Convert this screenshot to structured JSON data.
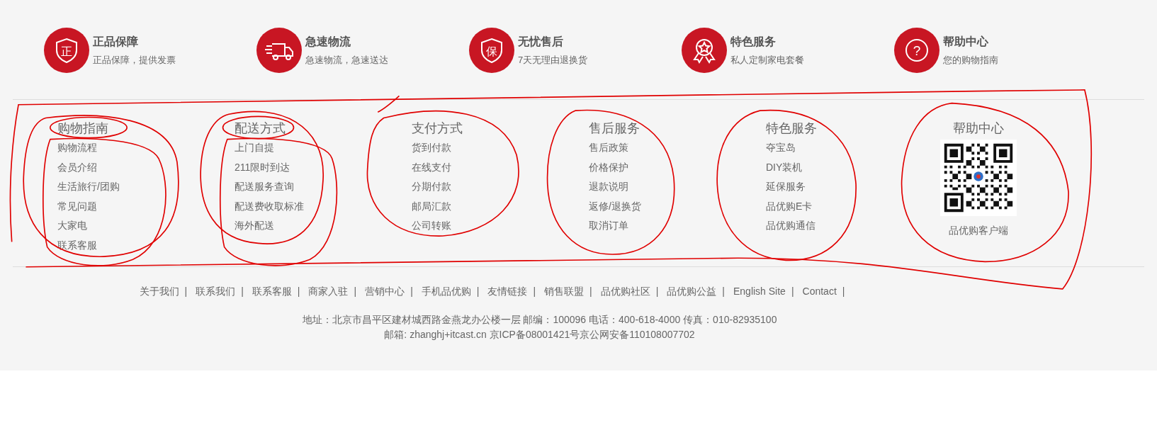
{
  "features": [
    {
      "kind": "shield",
      "glyph": "正",
      "title": "正品保障",
      "subtitle": "正品保障，提供发票"
    },
    {
      "kind": "truck",
      "title": "急速物流",
      "subtitle": "急速物流，急速送达"
    },
    {
      "kind": "shield",
      "glyph": "保",
      "title": "无忧售后",
      "subtitle": "7天无理由退换货"
    },
    {
      "kind": "medal",
      "title": "特色服务",
      "subtitle": "私人定制家电套餐"
    },
    {
      "kind": "question",
      "glyph": "?",
      "title": "帮助中心",
      "subtitle": "您的购物指南"
    }
  ],
  "columns": [
    {
      "kind": "list",
      "title": "购物指南",
      "items": [
        "购物流程",
        "会员介绍",
        "生活旅行/团购",
        "常见问题",
        "大家电",
        "联系客服"
      ]
    },
    {
      "kind": "list",
      "title": "配送方式",
      "items": [
        "上门自提",
        "211限时到达",
        "配送服务查询",
        "配送费收取标准",
        "海外配送"
      ]
    },
    {
      "kind": "list",
      "title": "支付方式",
      "items": [
        "货到付款",
        "在线支付",
        "分期付款",
        "邮局汇款",
        "公司转账"
      ]
    },
    {
      "kind": "list",
      "title": "售后服务",
      "items": [
        "售后政策",
        "价格保护",
        "退款说明",
        "返修/退换货",
        "取消订单"
      ]
    },
    {
      "kind": "list",
      "title": "特色服务",
      "items": [
        "夺宝岛",
        "DIY装机",
        "延保服务",
        "品优购E卡",
        "品优购通信"
      ]
    },
    {
      "kind": "qr",
      "title": "帮助中心",
      "caption": "品优购客户端"
    }
  ],
  "footer_links": [
    {
      "kind": "link",
      "text": "关于我们"
    },
    {
      "kind": "sep",
      "text": "|"
    },
    {
      "kind": "link",
      "text": "联系我们"
    },
    {
      "kind": "sep",
      "text": "|"
    },
    {
      "kind": "link",
      "text": "联系客服"
    },
    {
      "kind": "sep",
      "text": "|"
    },
    {
      "kind": "link",
      "text": "商家入驻"
    },
    {
      "kind": "sep",
      "text": "|"
    },
    {
      "kind": "link",
      "text": "营销中心"
    },
    {
      "kind": "sep",
      "text": "|"
    },
    {
      "kind": "link",
      "text": "手机品优购"
    },
    {
      "kind": "sep",
      "text": "|"
    },
    {
      "kind": "link",
      "text": "友情链接"
    },
    {
      "kind": "sep",
      "text": "|"
    },
    {
      "kind": "link",
      "text": "销售联盟"
    },
    {
      "kind": "sep",
      "text": "|"
    },
    {
      "kind": "link",
      "text": "品优购社区"
    },
    {
      "kind": "sep",
      "text": "|"
    },
    {
      "kind": "link",
      "text": "品优购公益"
    },
    {
      "kind": "sep",
      "text": "|"
    },
    {
      "kind": "link",
      "text": "English Site"
    },
    {
      "kind": "sep",
      "text": "|"
    },
    {
      "kind": "link",
      "text": "Contact"
    },
    {
      "kind": "sep",
      "text": "|"
    }
  ],
  "address_lines": [
    "地址：北京市昌平区建材城西路金燕龙办公楼一层 邮编：100096 电话：400-618-4000 传真：010-82935100",
    "邮箱: zhanghj+itcast.cn 京ICP备08001421号京公网安备110108007702"
  ]
}
